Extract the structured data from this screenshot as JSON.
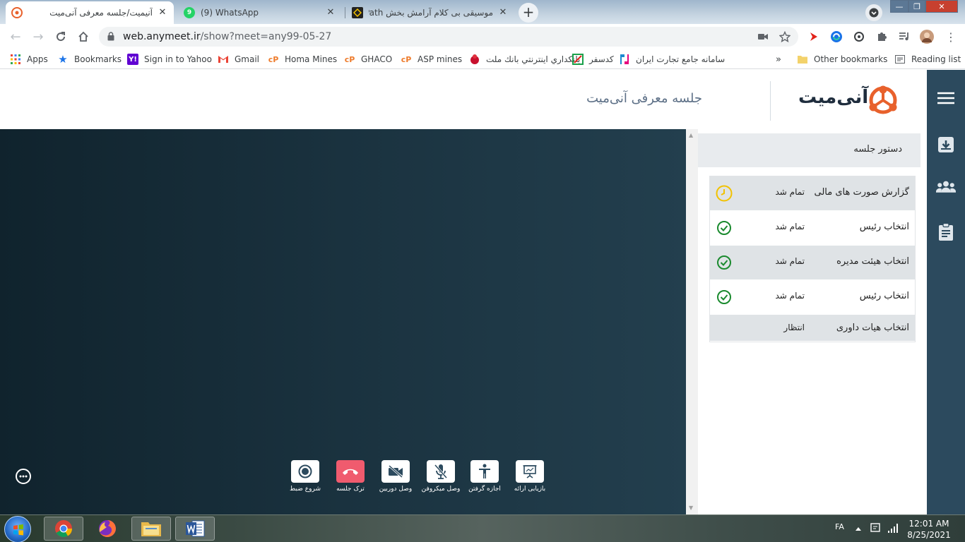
{
  "browser": {
    "tabs": [
      {
        "title": "آنیمیت/جلسه معرفی آنی‌میت",
        "active": true,
        "close": "✕"
      },
      {
        "title": "(9) WhatsApp",
        "active": false,
        "badge": "9",
        "close": "✕"
      },
      {
        "title": "موسیقی بی کلام آرامش بخش Seven Path",
        "active": false,
        "close": "✕"
      }
    ],
    "new_tab": "+",
    "url_host": "web.anymeet.ir",
    "url_path": "/show?meet=any99-05-27",
    "bookmarks": [
      {
        "label": "Apps",
        "icon": "apps-grid-icon"
      },
      {
        "label": "Bookmarks",
        "icon": "star-icon"
      },
      {
        "label": "Sign in to Yahoo",
        "icon": "yahoo-icon"
      },
      {
        "label": "Gmail",
        "icon": "gmail-icon"
      },
      {
        "label": "Homa Mines",
        "icon": "cp-icon"
      },
      {
        "label": "GHACO",
        "icon": "cp-icon"
      },
      {
        "label": "ASP mines",
        "icon": "cp-icon"
      },
      {
        "label": "بانكداري اينترنتي بانك ملت",
        "icon": "mellat-icon"
      },
      {
        "label": "کدسفر",
        "icon": "kadsafar-icon"
      },
      {
        "label": "سامانه جامع تجارت ایران",
        "icon": "ntsw-icon"
      }
    ],
    "overflow": "»",
    "other_bookmarks": "Other bookmarks",
    "reading_list": "Reading list"
  },
  "app": {
    "logo_text": "آنی‌میت",
    "meeting_title": "جلسه معرفی آنی‌میت",
    "brand_color": "#e8612c",
    "rail_color": "#2c4a5e"
  },
  "agenda": {
    "title": "دستور جلسه",
    "items": [
      {
        "name": "گزارش صورت های مالی",
        "status": "تمام شد",
        "icon": "clock-icon",
        "shaded": true
      },
      {
        "name": "انتخاب رئیس",
        "status": "تمام شد",
        "icon": "check-circle-icon",
        "shaded": false
      },
      {
        "name": "انتخاب هیئت مدیره",
        "status": "تمام شد",
        "icon": "check-circle-icon",
        "shaded": true
      },
      {
        "name": "انتخاب رئیس",
        "status": "تمام شد",
        "icon": "check-circle-icon",
        "shaded": false
      },
      {
        "name": "انتخاب هیات داوری",
        "status": "انتظار",
        "icon": "",
        "shaded": true
      }
    ]
  },
  "controls": [
    {
      "label": "شروع ضبط",
      "icon": "record-icon"
    },
    {
      "label": "ترک جلسه",
      "icon": "hangup-icon"
    },
    {
      "label": "وصل دوربین",
      "icon": "camera-off-icon"
    },
    {
      "label": "وصل میکروفن",
      "icon": "mic-off-icon"
    },
    {
      "label": "اجازه گرفتن",
      "icon": "raise-hand-icon"
    },
    {
      "label": "بازیابی ارائه",
      "icon": "presentation-icon"
    }
  ],
  "taskbar": {
    "language": "FA",
    "time": "12:01 AM",
    "date": "8/25/2021"
  }
}
